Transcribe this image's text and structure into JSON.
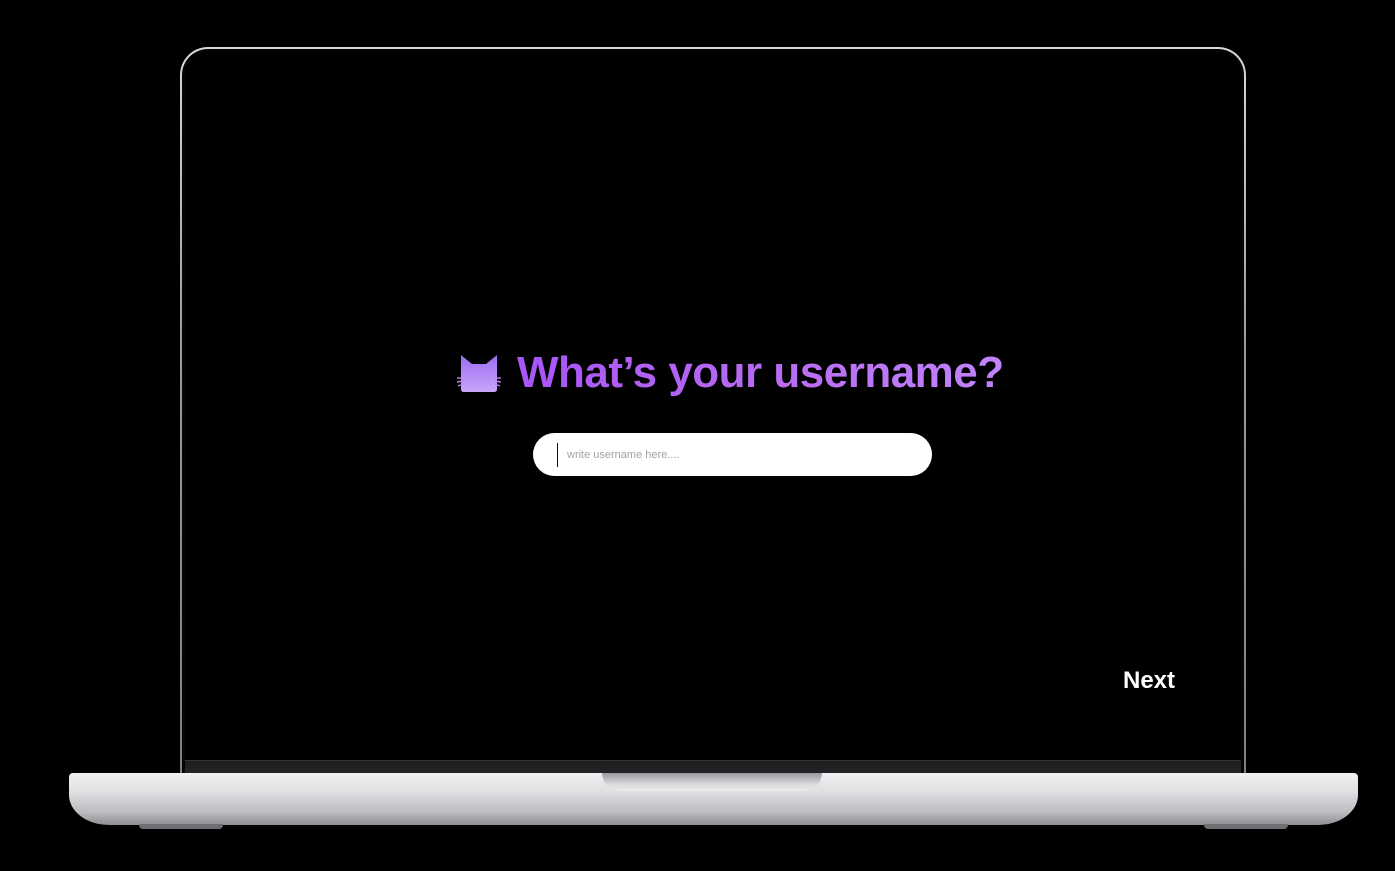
{
  "onboarding": {
    "title": "What’s your username?",
    "title_icon": "cat-face-icon",
    "username_input": {
      "value": "",
      "placeholder": "write username here...."
    },
    "next_label": "Next"
  },
  "colors": {
    "background": "#000000",
    "title_gradient_start": "#a855f7",
    "title_gradient_end": "#c084fc",
    "icon_color": "#b985f7",
    "input_background": "#ffffff",
    "next_text": "#ffffff"
  }
}
